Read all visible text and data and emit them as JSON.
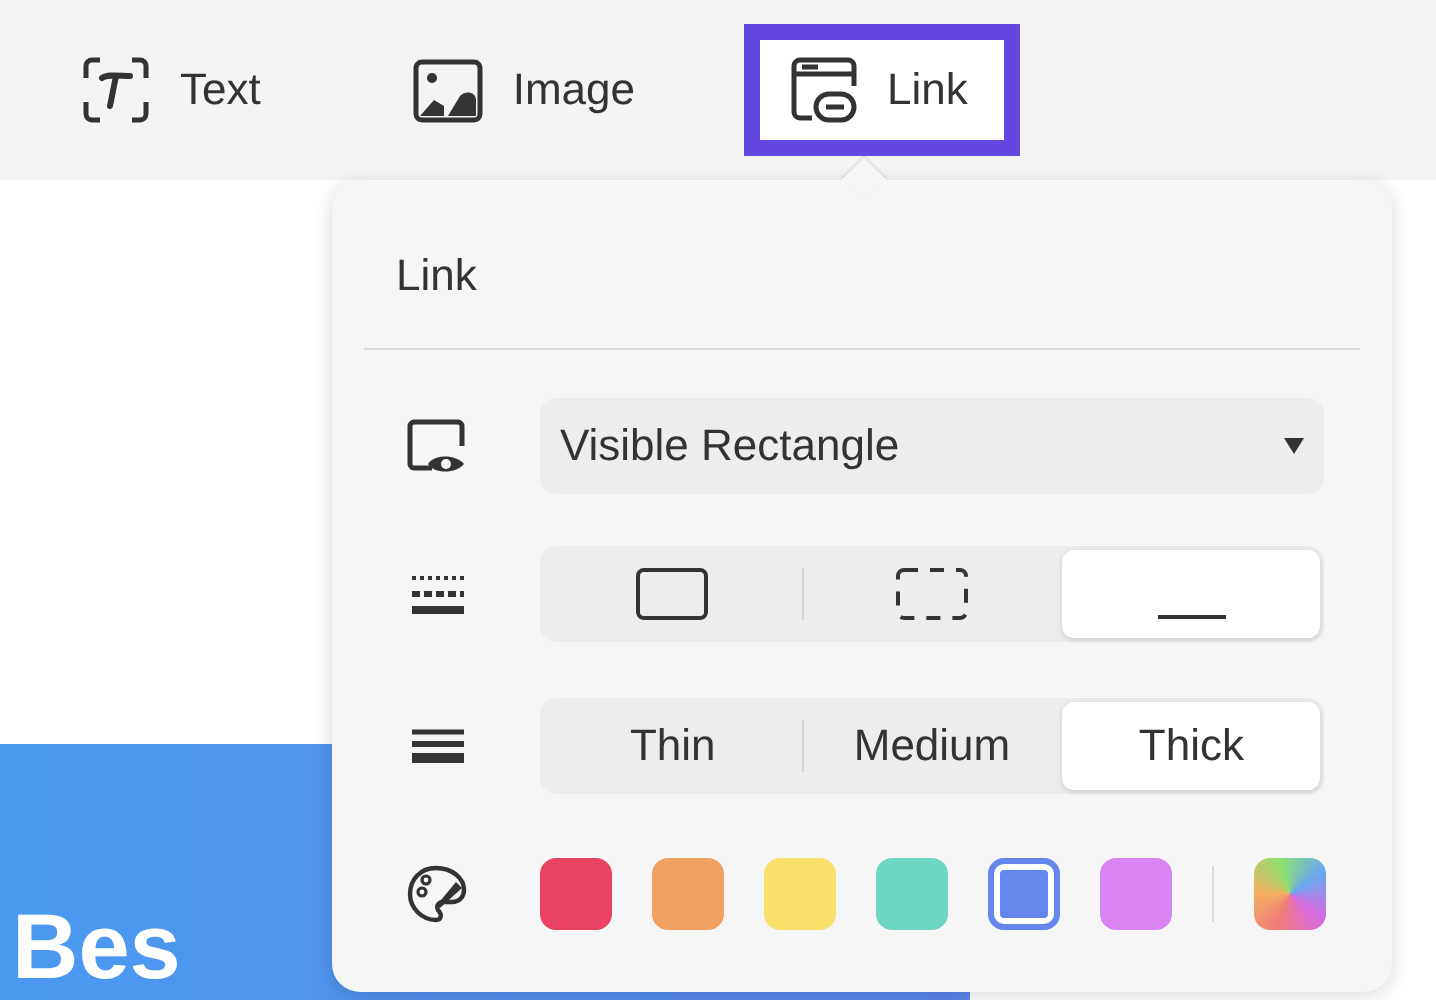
{
  "toolbar": {
    "items": [
      {
        "kind": "text",
        "label": "Text",
        "selected": false
      },
      {
        "kind": "image",
        "label": "Image",
        "selected": false
      },
      {
        "kind": "link",
        "label": "Link",
        "selected": true
      }
    ]
  },
  "banner": {
    "text": "Bes"
  },
  "popover": {
    "title": "Link",
    "link_type": {
      "value": "Visible Rectangle"
    },
    "border_styles": [
      {
        "kind": "solid",
        "selected": false
      },
      {
        "kind": "dashed",
        "selected": false
      },
      {
        "kind": "underline",
        "selected": true
      }
    ],
    "thickness": [
      {
        "label": "Thin",
        "selected": false
      },
      {
        "label": "Medium",
        "selected": false
      },
      {
        "label": "Thick",
        "selected": true
      }
    ],
    "colors": [
      {
        "color": "#e84462",
        "selected": false
      },
      {
        "color": "#f0a062",
        "selected": false
      },
      {
        "color": "#f8e06a",
        "selected": false
      },
      {
        "color": "#6cd6c0",
        "selected": false
      },
      {
        "color": "#6586ec",
        "selected": true
      },
      {
        "color": "#d884f2",
        "selected": false
      }
    ]
  }
}
